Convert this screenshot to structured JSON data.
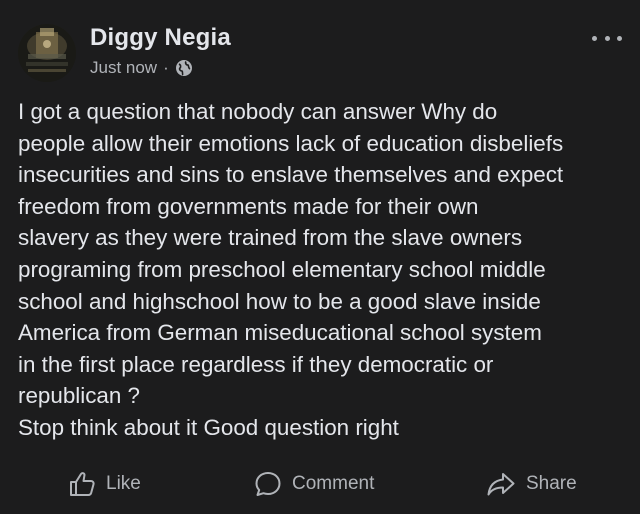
{
  "post": {
    "author_name": "Diggy Negia",
    "timestamp": "Just now",
    "separator": "·",
    "audience_icon": "globe-icon",
    "body": "I got a question that nobody can answer Why do\npeople allow their emotions lack of education disbeliefs\ninsecurities and sins to enslave themselves and expect\nfreedom from governments made for their own\nslavery as they were trained from the slave owners\nprograming from preschool elementary school middle\nschool and highschool how to be a good slave inside\nAmerica from German miseducational school system\nin the first place regardless if they democratic or\nrepublican ?\nStop think about it Good question right"
  },
  "actions": {
    "like_label": "Like",
    "comment_label": "Comment",
    "share_label": "Share"
  },
  "colors": {
    "background": "#1c1c1d",
    "primary_text": "#e4e6eb",
    "secondary_text": "#b0b3b8"
  }
}
